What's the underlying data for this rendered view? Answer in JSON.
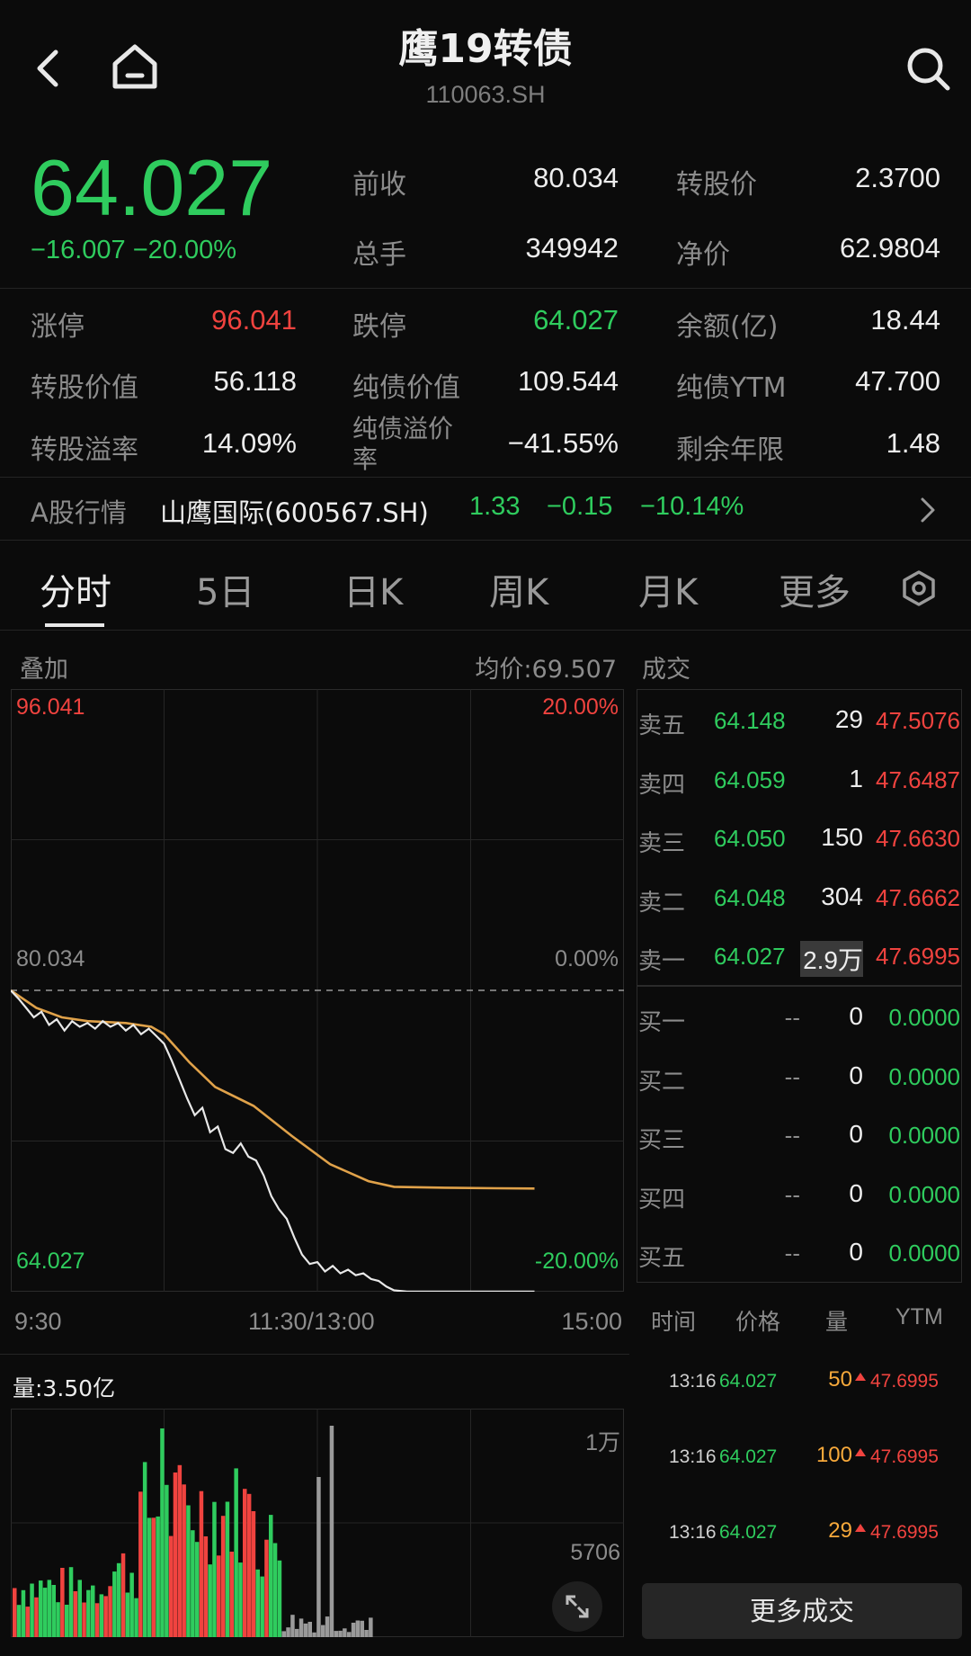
{
  "header": {
    "title": "鹰19转债",
    "code": "110063.SH",
    "back_icon": "chevron-left-icon",
    "home_icon": "home-icon",
    "search_icon": "search-icon"
  },
  "quote": {
    "price": "64.027",
    "change": "−16.007 −20.00%",
    "prev_close_label": "前收",
    "prev_close": "80.034",
    "conv_price_label": "转股价",
    "conv_price": "2.3700",
    "volume_label": "总手",
    "volume": "349942",
    "clean_price_label": "净价",
    "clean_price": "62.9804",
    "limit_up_label": "涨停",
    "limit_up": "96.041",
    "limit_down_label": "跌停",
    "limit_down": "64.027",
    "balance_label": "余额(亿)",
    "balance": "18.44",
    "conv_value_label": "转股价值",
    "conv_value": "56.118",
    "bond_value_label": "纯债价值",
    "bond_value": "109.544",
    "bond_ytm_label": "纯债YTM",
    "bond_ytm": "47.700",
    "conv_premium_label": "转股溢率",
    "conv_premium": "14.09%",
    "bond_premium_label_1": "纯债溢价",
    "bond_premium_label_2": "率",
    "bond_premium": "−41.55%",
    "remaining_years_label": "剩余年限",
    "remaining_years": "1.48"
  },
  "stock": {
    "label": "A股行情",
    "name": "山鹰国际(600567.SH)",
    "price": "1.33",
    "change": "−0.15",
    "pct": "−10.14%"
  },
  "tabs": [
    "分时",
    "5日",
    "日K",
    "周K",
    "月K",
    "更多"
  ],
  "chart": {
    "overlay_label": "叠加",
    "avg_price": "均价:69.507",
    "top_price": "96.041",
    "top_pct": "20.00%",
    "mid_price": "80.034",
    "mid_pct": "0.00%",
    "bottom_price": "64.027",
    "bottom_pct": "-20.00%",
    "time_start": "9:30",
    "time_mid": "11:30/13:00",
    "time_end": "15:00",
    "volume_label": "量:3.50亿",
    "vol_top": "1万",
    "vol_mid": "5706",
    "expand_icon": "expand-icon",
    "colors": {
      "up": "#f0433f",
      "down": "#2fcc5e",
      "avg": "#e0a24a",
      "price": "#e8e8e8"
    }
  },
  "chart_data": {
    "type": "line",
    "ylim": [
      64.027,
      96.041
    ],
    "x_range": [
      0,
      240
    ],
    "price_series": [
      [
        0,
        80.03
      ],
      [
        3,
        79.6
      ],
      [
        6,
        79.1
      ],
      [
        9,
        78.6
      ],
      [
        12,
        78.9
      ],
      [
        15,
        78.2
      ],
      [
        18,
        78.5
      ],
      [
        21,
        77.9
      ],
      [
        24,
        78.4
      ],
      [
        27,
        78.1
      ],
      [
        30,
        78.3
      ],
      [
        33,
        78.0
      ],
      [
        36,
        78.4
      ],
      [
        39,
        78.1
      ],
      [
        42,
        78.3
      ],
      [
        45,
        77.9
      ],
      [
        48,
        78.2
      ],
      [
        51,
        77.7
      ],
      [
        54,
        78.0
      ],
      [
        57,
        77.6
      ],
      [
        60,
        77.2
      ],
      [
        63,
        76.3
      ],
      [
        66,
        75.3
      ],
      [
        69,
        74.3
      ],
      [
        72,
        73.4
      ],
      [
        75,
        73.8
      ],
      [
        78,
        72.5
      ],
      [
        81,
        72.8
      ],
      [
        84,
        71.6
      ],
      [
        87,
        71.4
      ],
      [
        90,
        71.9
      ],
      [
        93,
        71.2
      ],
      [
        96,
        71.0
      ],
      [
        99,
        70.2
      ],
      [
        102,
        69.1
      ],
      [
        105,
        68.4
      ],
      [
        108,
        67.9
      ],
      [
        111,
        66.9
      ],
      [
        114,
        66.0
      ],
      [
        117,
        65.5
      ],
      [
        120,
        65.6
      ],
      [
        123,
        65.1
      ],
      [
        126,
        65.4
      ],
      [
        129,
        65.0
      ],
      [
        132,
        65.2
      ],
      [
        135,
        64.9
      ],
      [
        138,
        65.0
      ],
      [
        141,
        64.7
      ],
      [
        144,
        64.6
      ],
      [
        147,
        64.3
      ],
      [
        150,
        64.1
      ],
      [
        155,
        64.03
      ],
      [
        160,
        64.03
      ],
      [
        170,
        64.03
      ],
      [
        180,
        64.03
      ],
      [
        190,
        64.03
      ],
      [
        200,
        64.03
      ],
      [
        205,
        64.03
      ]
    ],
    "avg_series": [
      [
        0,
        80.03
      ],
      [
        10,
        79.1
      ],
      [
        20,
        78.6
      ],
      [
        30,
        78.4
      ],
      [
        45,
        78.3
      ],
      [
        55,
        78.1
      ],
      [
        60,
        77.7
      ],
      [
        70,
        76.2
      ],
      [
        80,
        74.9
      ],
      [
        95,
        73.9
      ],
      [
        110,
        72.3
      ],
      [
        125,
        70.8
      ],
      [
        140,
        69.9
      ],
      [
        150,
        69.6
      ],
      [
        170,
        69.55
      ],
      [
        190,
        69.52
      ],
      [
        205,
        69.507
      ]
    ],
    "volume_series_note": "per-minute volume bars, red up / green down",
    "vol_ylim": [
      0,
      11000
    ]
  },
  "orderbook": {
    "title": "成交",
    "asks": [
      {
        "label": "卖五",
        "price": "64.148",
        "vol": "29",
        "ytm": "47.5076"
      },
      {
        "label": "卖四",
        "price": "64.059",
        "vol": "1",
        "ytm": "47.6487"
      },
      {
        "label": "卖三",
        "price": "64.050",
        "vol": "150",
        "ytm": "47.6630"
      },
      {
        "label": "卖二",
        "price": "64.048",
        "vol": "304",
        "ytm": "47.6662"
      },
      {
        "label": "卖一",
        "price": "64.027",
        "vol": "2.9万",
        "ytm": "47.6995"
      }
    ],
    "bids": [
      {
        "label": "买一",
        "price": "--",
        "vol": "0",
        "ytm": "0.0000"
      },
      {
        "label": "买二",
        "price": "--",
        "vol": "0",
        "ytm": "0.0000"
      },
      {
        "label": "买三",
        "price": "--",
        "vol": "0",
        "ytm": "0.0000"
      },
      {
        "label": "买四",
        "price": "--",
        "vol": "0",
        "ytm": "0.0000"
      },
      {
        "label": "买五",
        "price": "--",
        "vol": "0",
        "ytm": "0.0000"
      }
    ]
  },
  "trades": {
    "headers": [
      "时间",
      "价格",
      "量",
      "YTM"
    ],
    "rows": [
      {
        "time": "13:16",
        "price": "64.027",
        "vol": "50",
        "ytm": "47.6995"
      },
      {
        "time": "13:16",
        "price": "64.027",
        "vol": "100",
        "ytm": "47.6995"
      },
      {
        "time": "13:16",
        "price": "64.027",
        "vol": "29",
        "ytm": "47.6995"
      }
    ],
    "more_label": "更多成交"
  }
}
